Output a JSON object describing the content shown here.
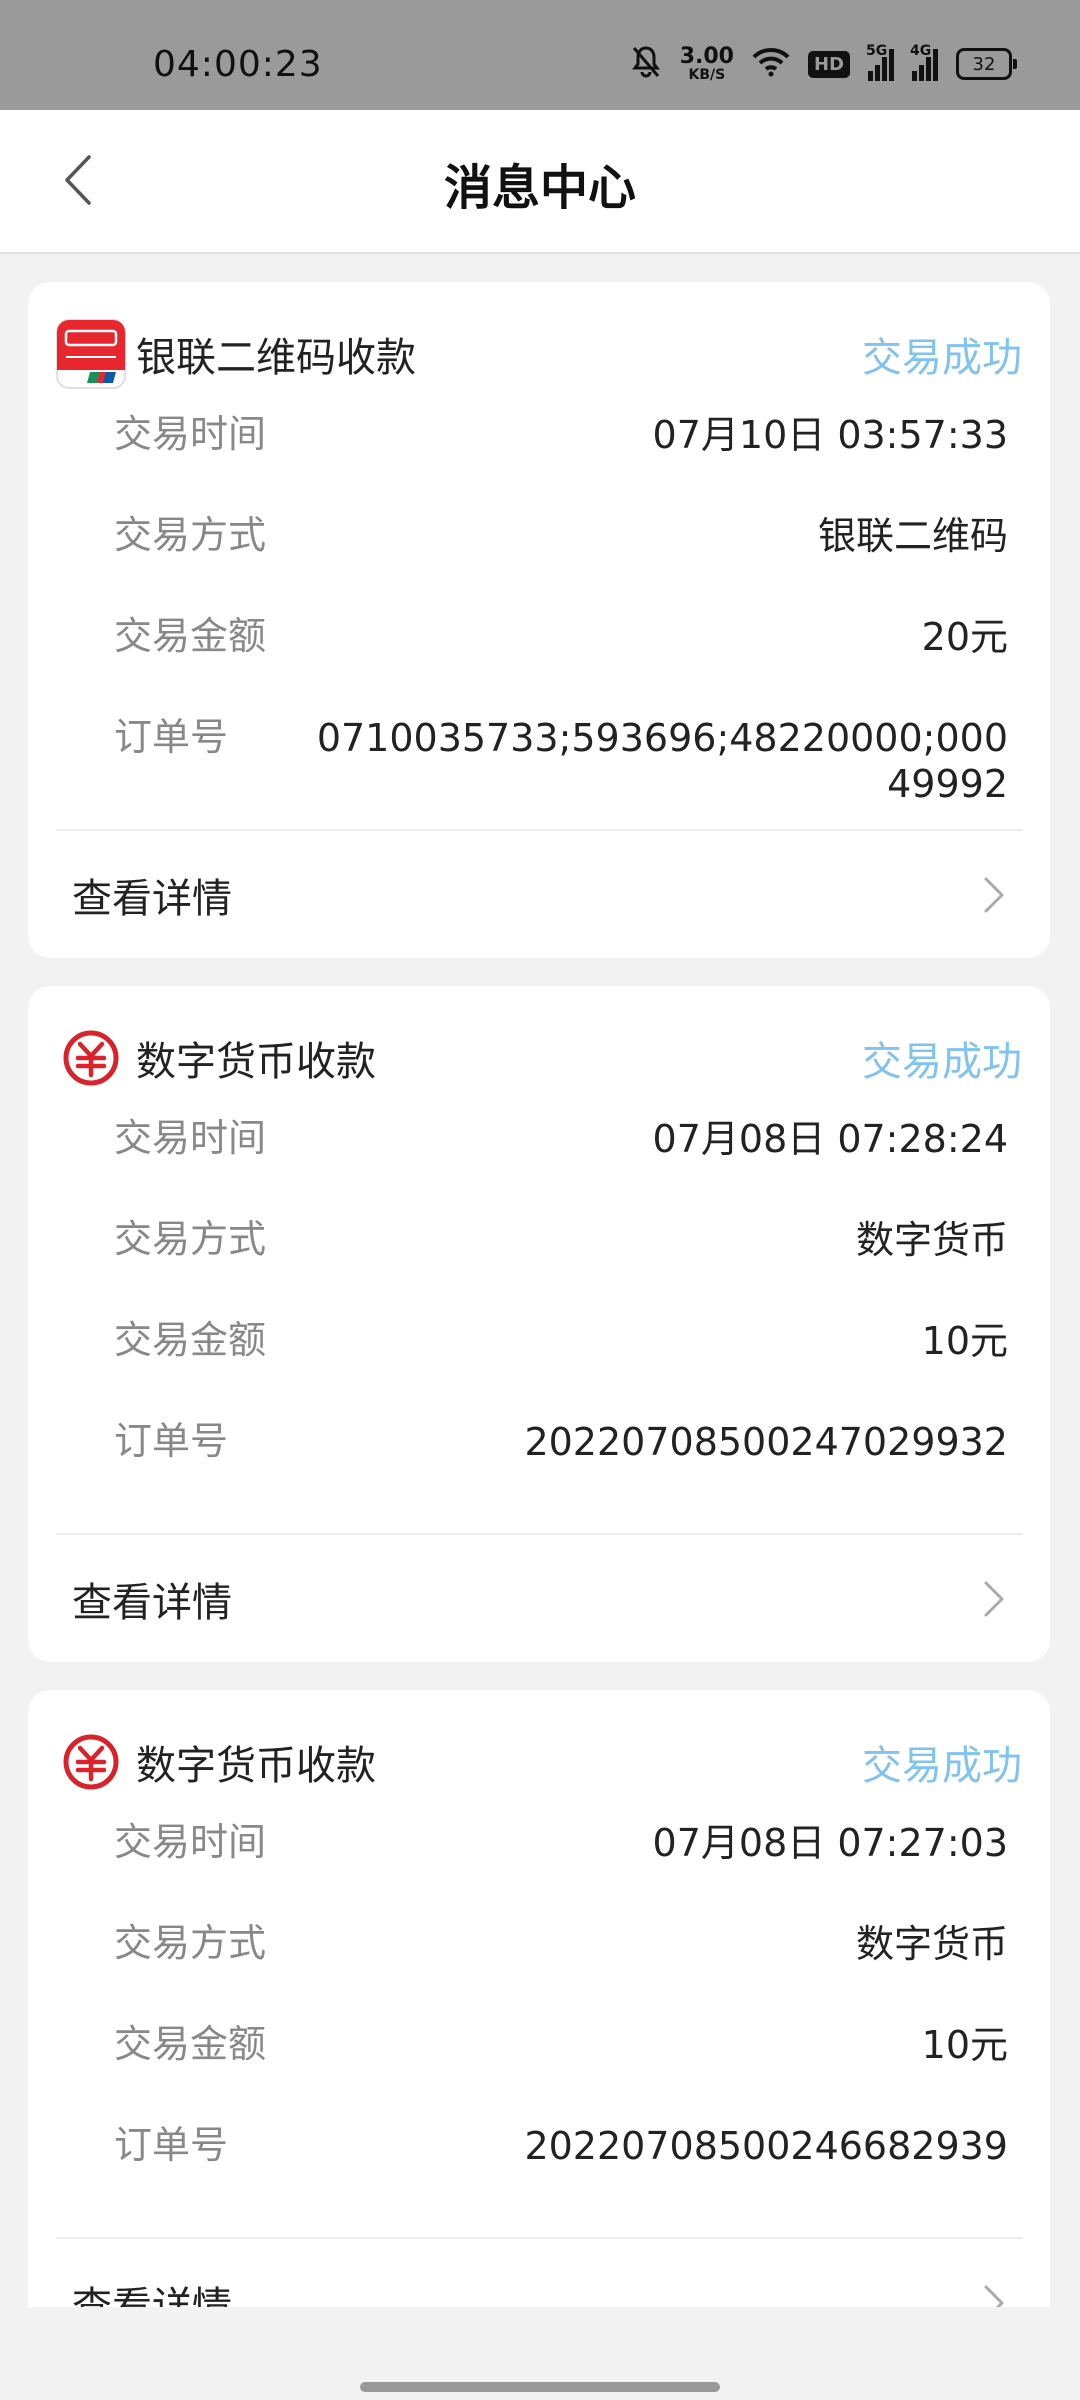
{
  "status_bar": {
    "time": "04:00:23",
    "net_speed_value": "3.00",
    "net_speed_unit": "KB/S",
    "hd_badge": "HD",
    "signal_1_label": "5G",
    "signal_2_label": "4G",
    "battery": "32"
  },
  "header": {
    "title": "消息中心"
  },
  "cards": [
    {
      "icon": "unionpay-icon",
      "title": "银联二维码收款",
      "status": "交易成功",
      "rows": [
        {
          "label": "交易时间",
          "value": "07月10日 03:57:33"
        },
        {
          "label": "交易方式",
          "value": "银联二维码"
        },
        {
          "label": "交易金额",
          "value": "20元"
        },
        {
          "label": "订单号",
          "value": "0710035733;593696;48220000;00049992"
        }
      ],
      "details_label": "查看详情"
    },
    {
      "icon": "digital-currency-icon",
      "title": "数字货币收款",
      "status": "交易成功",
      "rows": [
        {
          "label": "交易时间",
          "value": "07月08日 07:28:24"
        },
        {
          "label": "交易方式",
          "value": "数字货币"
        },
        {
          "label": "交易金额",
          "value": "10元"
        },
        {
          "label": "订单号",
          "value": "2022070850024702993​2"
        }
      ],
      "details_label": "查看详情"
    },
    {
      "icon": "digital-currency-icon",
      "title": "数字货币收款",
      "status": "交易成功",
      "rows": [
        {
          "label": "交易时间",
          "value": "07月08日 07:27:03"
        },
        {
          "label": "交易方式",
          "value": "数字货币"
        },
        {
          "label": "交易金额",
          "value": "10元"
        },
        {
          "label": "订单号",
          "value": "20220708500246682939"
        }
      ],
      "details_label": "查看详情"
    }
  ],
  "colors": {
    "status_success": "#7fc3ee",
    "unionpay_red": "#e8262e",
    "digital_currency_red": "#d9232a"
  }
}
